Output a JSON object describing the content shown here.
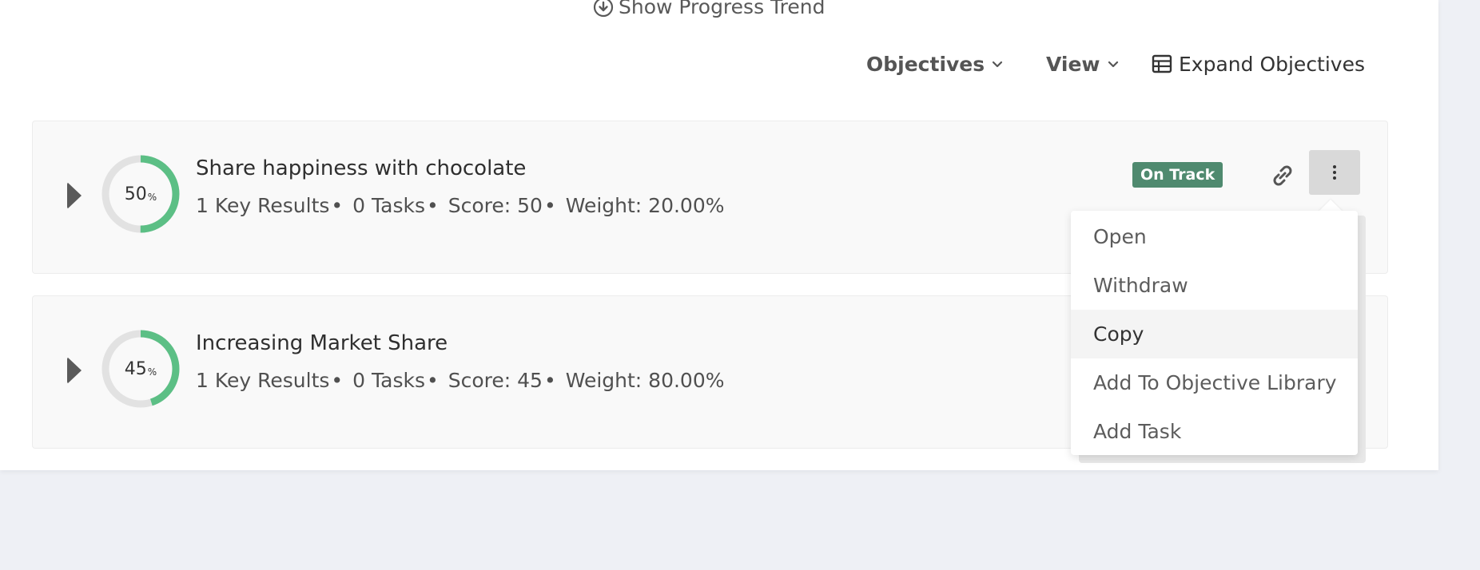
{
  "toolbar": {
    "progress_trend_label": "Show Progress Trend",
    "objectives_label": "Objectives",
    "view_label": "View",
    "expand_label": "Expand Objectives"
  },
  "objectives": [
    {
      "progress": 50,
      "progress_text": "50",
      "unit": "%",
      "title": "Share happiness with chocolate",
      "key_results": "1 Key Results",
      "tasks": "0 Tasks",
      "score": "Score: 50",
      "weight": "Weight: 20.00%",
      "status": "On Track"
    },
    {
      "progress": 45,
      "progress_text": "45",
      "unit": "%",
      "title": "Increasing Market Share",
      "key_results": "1 Key Results",
      "tasks": "0 Tasks",
      "score": "Score: 45",
      "weight": "Weight: 80.00%"
    }
  ],
  "separator": "•",
  "context_menu": {
    "items": [
      "Open",
      "Withdraw",
      "Copy",
      "Add To Objective Library",
      "Add Task"
    ]
  },
  "colors": {
    "progress_ring": "#5cbf85",
    "ring_track": "#e2e2e2",
    "status_on_track": "#4f8a6f"
  },
  "icons": {
    "progress_trend": "download-circle-icon",
    "dropdown": "chevron-down-icon",
    "expand": "table-icon",
    "link": "link-icon",
    "menu": "vertical-ellipsis-icon",
    "expand_row": "caret-right-icon"
  }
}
